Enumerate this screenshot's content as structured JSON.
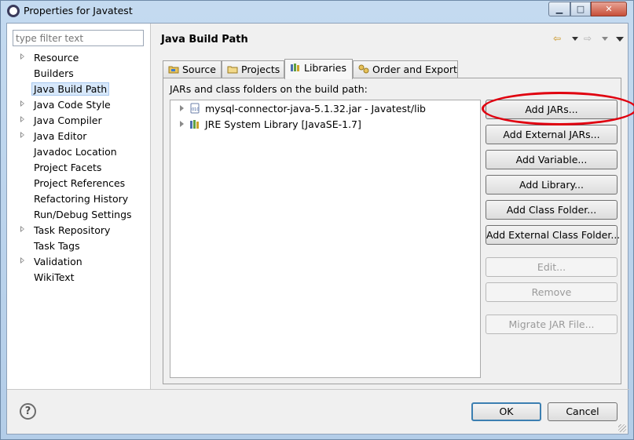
{
  "window": {
    "title": "Properties for Javatest"
  },
  "filter": {
    "placeholder": "type filter text"
  },
  "nav": {
    "items": [
      {
        "label": "Resource",
        "expandable": true,
        "selected": false
      },
      {
        "label": "Builders",
        "expandable": false,
        "selected": false
      },
      {
        "label": "Java Build Path",
        "expandable": false,
        "selected": true
      },
      {
        "label": "Java Code Style",
        "expandable": true,
        "selected": false
      },
      {
        "label": "Java Compiler",
        "expandable": true,
        "selected": false
      },
      {
        "label": "Java Editor",
        "expandable": true,
        "selected": false
      },
      {
        "label": "Javadoc Location",
        "expandable": false,
        "selected": false
      },
      {
        "label": "Project Facets",
        "expandable": false,
        "selected": false
      },
      {
        "label": "Project References",
        "expandable": false,
        "selected": false
      },
      {
        "label": "Refactoring History",
        "expandable": false,
        "selected": false
      },
      {
        "label": "Run/Debug Settings",
        "expandable": false,
        "selected": false
      },
      {
        "label": "Task Repository",
        "expandable": true,
        "selected": false
      },
      {
        "label": "Task Tags",
        "expandable": false,
        "selected": false
      },
      {
        "label": "Validation",
        "expandable": true,
        "selected": false
      },
      {
        "label": "WikiText",
        "expandable": false,
        "selected": false
      }
    ]
  },
  "page": {
    "title": "Java Build Path"
  },
  "tabs": [
    {
      "label": "Source",
      "icon": "source-folder-icon",
      "active": false
    },
    {
      "label": "Projects",
      "icon": "projects-icon",
      "active": false
    },
    {
      "label": "Libraries",
      "icon": "libraries-icon",
      "active": true
    },
    {
      "label": "Order and Export",
      "icon": "order-export-icon",
      "active": false
    }
  ],
  "panel": {
    "label": "JARs and class folders on the build path:",
    "libraries": [
      {
        "label": "mysql-connector-java-5.1.32.jar - Javatest/lib",
        "icon": "jar-icon"
      },
      {
        "label": "JRE System Library [JavaSE-1.7]",
        "icon": "jre-library-icon"
      }
    ],
    "buttons": [
      {
        "label": "Add JARs...",
        "enabled": true
      },
      {
        "label": "Add External JARs...",
        "enabled": true
      },
      {
        "label": "Add Variable...",
        "enabled": true
      },
      {
        "label": "Add Library...",
        "enabled": true
      },
      {
        "label": "Add Class Folder...",
        "enabled": true
      },
      {
        "label": "Add External Class Folder...",
        "enabled": true
      },
      {
        "label": "Edit...",
        "enabled": false
      },
      {
        "label": "Remove",
        "enabled": false
      },
      {
        "label": "Migrate JAR File...",
        "enabled": false
      }
    ]
  },
  "footer": {
    "ok": "OK",
    "cancel": "Cancel",
    "help": "?"
  },
  "colors": {
    "highlight_oval": "#e0000f",
    "selection": "#d7e8fb",
    "accent": "#3c7fb1"
  }
}
